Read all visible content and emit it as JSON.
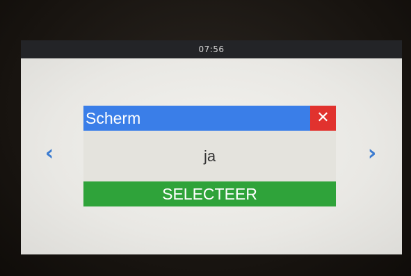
{
  "status_bar": {
    "time": "07:56"
  },
  "navigation": {
    "prev_icon": "‹",
    "next_icon": "›"
  },
  "dialog": {
    "title": "Scherm",
    "close_icon": "✕",
    "value": "ja",
    "select_label": "SELECTEER"
  },
  "colors": {
    "header_blue": "#3a7ee8",
    "close_red": "#e1322e",
    "select_green": "#2fa33a",
    "arrow_blue": "#3b7bd0"
  }
}
